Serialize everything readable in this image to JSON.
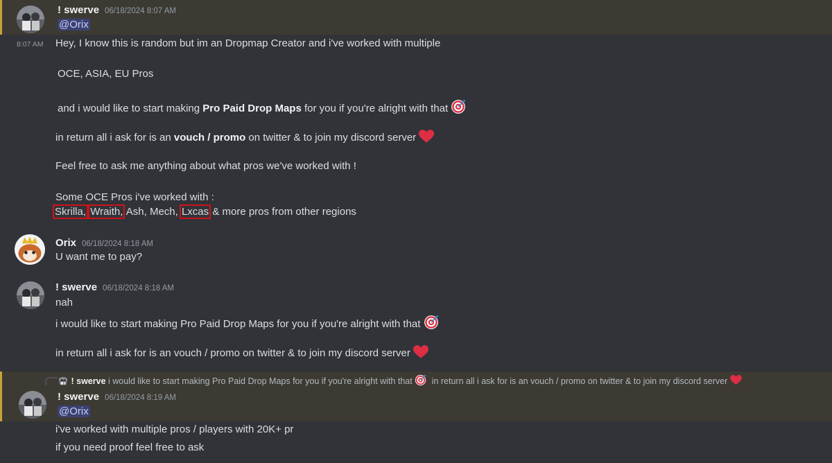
{
  "messages": [
    {
      "author": "! swerve",
      "timestamp": "06/18/2024 8:07 AM",
      "mention": "@Orix",
      "side_time": "8:07 AM",
      "lines": [
        "Hey, I know this is random but im an Dropmap Creator and i've worked with multiple",
        "OCE, ASIA, EU Pros",
        "and i would like to start making ",
        "Pro Paid Drop Maps",
        " for you if you're alright with that",
        "in return all i ask for is an ",
        "vouch / promo",
        " on twitter & to join my discord server",
        "Feel free to ask me anything about what pros we've worked with !",
        "Some OCE Pros i've worked with :",
        "Skrilla,",
        "Wraith,",
        " Ash, Mech, ",
        "Lxcas",
        " & more pros from other regions"
      ]
    },
    {
      "author": "Orix",
      "timestamp": "06/18/2024 8:18 AM",
      "text": "U want me to pay?"
    },
    {
      "author": "! swerve",
      "timestamp": "06/18/2024 8:18 AM",
      "lines": [
        "nah",
        "i would like to start making Pro Paid Drop Maps for you if you're alright with that",
        "in return all i ask for is an vouch / promo on twitter & to join my discord server"
      ]
    },
    {
      "reply_author": "! swerve",
      "reply_text": "i would like to start making Pro Paid Drop Maps for you if you're alright with that",
      "reply_text2": "in return all i ask for is an vouch / promo on twitter & to join my discord server",
      "author": "! swerve",
      "timestamp": "06/18/2024 8:19 AM",
      "mention": "@Orix",
      "lines": [
        "i've worked with multiple pros / players with 20K+ pr",
        "if you need proof feel free to ask"
      ]
    }
  ],
  "icons": [
    "avatar-swerve",
    "avatar-orix",
    "direct-hit-emoji",
    "red-heart-emoji"
  ],
  "colors": {
    "background": "#313338",
    "mention_highlight": "#3c3a33",
    "mention_bar": "#c9a13a",
    "redbox": "#d0121a"
  }
}
